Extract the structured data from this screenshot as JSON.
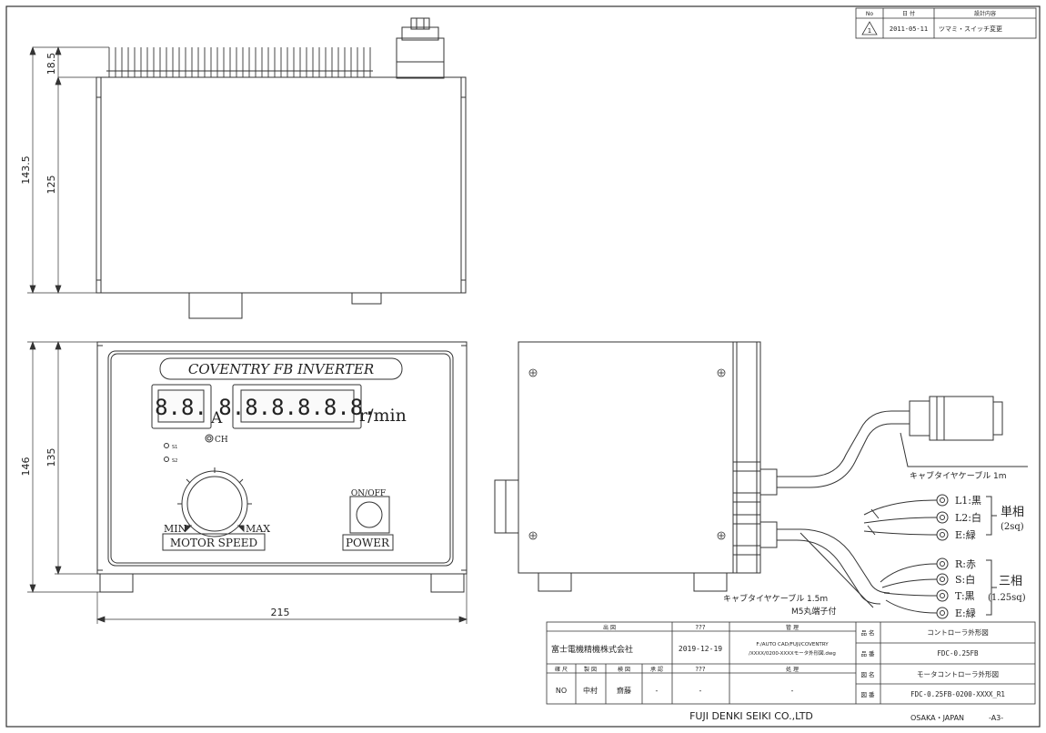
{
  "revision": {
    "headers": {
      "no": "No",
      "date": "日 付",
      "content": "設計内容"
    },
    "row": {
      "mark": "1",
      "date": "2011-05-11",
      "content": "ツマミ・スイッチ変更"
    }
  },
  "dimensions": {
    "heatsink_height": "18.5",
    "body_height_top": "125",
    "total_height_top": "143.5",
    "total_height_front": "146",
    "body_height_front": "135",
    "width": "215"
  },
  "front_panel": {
    "title": "COVENTRY  FB  INVERTER",
    "amp_display": "8.8.",
    "amp_unit": "A",
    "rpm_display": "8.8.8.8.8.8.",
    "rpm_unit": "r/min",
    "ch_label": "CH",
    "led1": "S1",
    "led2": "S2",
    "min_label": "MIN",
    "max_label": "MAX",
    "motor_speed_label": "MOTOR SPEED",
    "on_off_label": "ON/OFF",
    "power_label": "POWER"
  },
  "side_view": {
    "cable_1_note": "キャブタイヤケーブル 1m",
    "cable_2_note": "キャブタイヤケーブル 1.5m",
    "terminal_note": "M5丸端子付",
    "single_phase": {
      "title": "単相",
      "spec": "(2sq)",
      "wires": [
        "L1:黒",
        "L2:白",
        "E:緑"
      ]
    },
    "three_phase": {
      "title": "三相",
      "spec": "(1.25sq)",
      "wires": [
        "R:赤",
        "S:白",
        "T:黒",
        "E:緑"
      ]
    }
  },
  "title_block": {
    "drawn_by_header": "出 図",
    "unknown_header_1": "???",
    "management_header": "管 理",
    "company": "富士電機精機株式会社",
    "date": "2019-12-19",
    "file_path_1": "F:/AUTO CAD/FUJI/COVENTRY",
    "file_path_2": "/XXXX/0200-XXXXモータ外形図.dwg",
    "role_headers": [
      "確 尺",
      "製 図",
      "検 図",
      "承 認"
    ],
    "unknown_header_2": "???",
    "processing_header": "処 理",
    "scale": "NO",
    "drafter": "中村",
    "checker": "齋藤",
    "approver": "-",
    "dash_1": "-",
    "dash_2": "-",
    "fields": [
      {
        "label": "品 名",
        "value": "コントローラ外形図"
      },
      {
        "label": "品 番",
        "value": "FDC-0.25FB"
      },
      {
        "label": "図 名",
        "value": "モータコントローラ外形図"
      },
      {
        "label": "図 番",
        "value": "FDC-0.25FB-0200-XXXX_R1"
      }
    ],
    "company_en": "FUJI DENKI SEIKI CO.,LTD",
    "location": "OSAKA・JAPAN",
    "sheet_size": "-A3-"
  }
}
